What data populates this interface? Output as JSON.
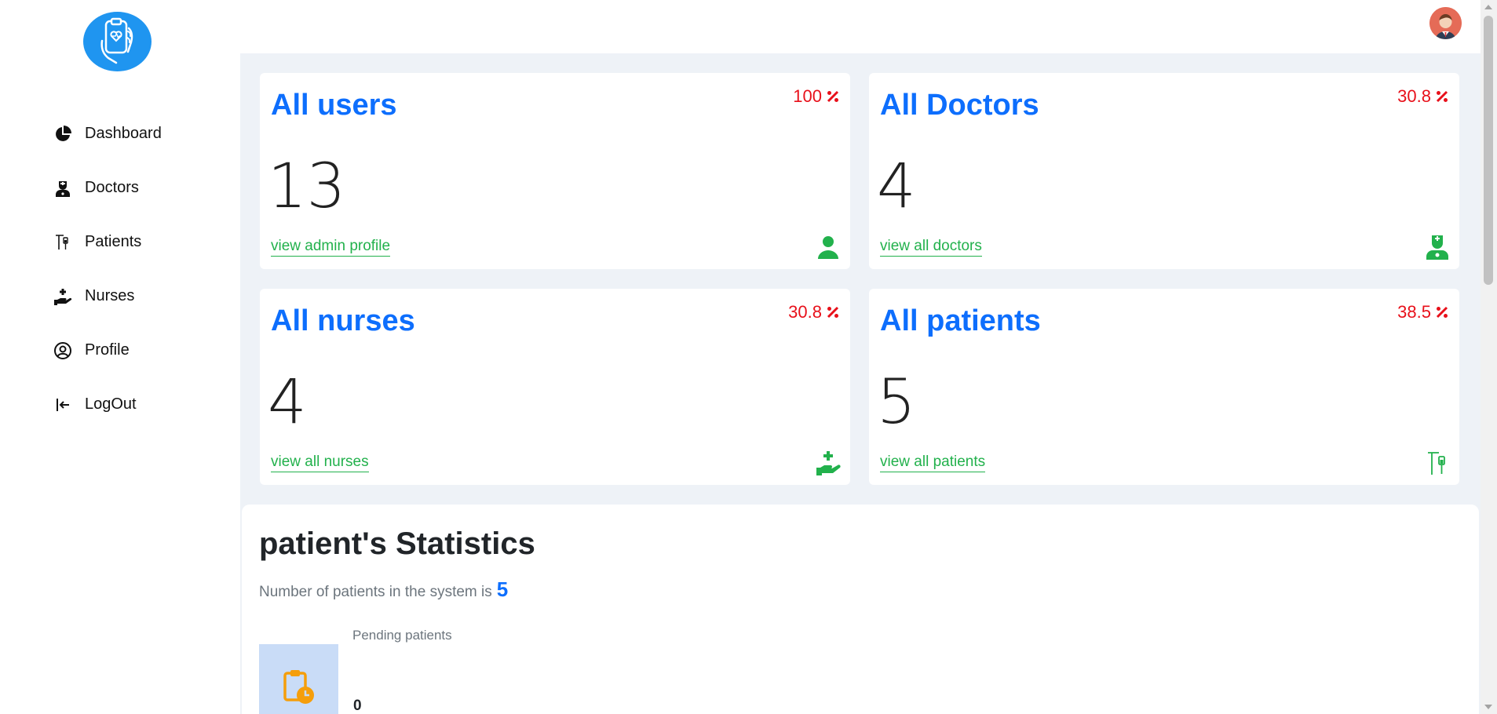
{
  "sidebar": {
    "logo_icon": "clipboard-heart-hand-icon",
    "items": [
      {
        "label": "Dashboard",
        "icon": "pie-chart-icon"
      },
      {
        "label": "Doctors",
        "icon": "doctor-icon"
      },
      {
        "label": "Patients",
        "icon": "iv-drip-icon"
      },
      {
        "label": "Nurses",
        "icon": "hand-plus-icon"
      },
      {
        "label": "Profile",
        "icon": "user-circle-icon"
      },
      {
        "label": "LogOut",
        "icon": "logout-icon"
      }
    ]
  },
  "header": {
    "avatar_icon": "user-avatar"
  },
  "cards": [
    {
      "title": "All users",
      "percent": "100",
      "count": "13",
      "link": "view admin profile",
      "icon": "user-icon"
    },
    {
      "title": "All Doctors",
      "percent": "30.8",
      "count": "4",
      "link": "view all doctors",
      "icon": "doctor-icon"
    },
    {
      "title": "All nurses",
      "percent": "30.8",
      "count": "4",
      "link": "view all nurses",
      "icon": "hand-plus-icon"
    },
    {
      "title": "All patients",
      "percent": "38.5",
      "count": "5",
      "link": "view all patients",
      "icon": "iv-drip-icon"
    }
  ],
  "statistics": {
    "title": "patient's Statistics",
    "subtitle": "Number of patients in the system is",
    "patient_count": "5",
    "pending_label": "Pending patients",
    "pending_value": "0",
    "pending_icon": "clipboard-clock-icon"
  },
  "colors": {
    "primary": "#0d6efd",
    "link_green": "#22b14c",
    "percent_red": "#e8101a",
    "logo_blue": "#1f95f0",
    "pending_box": "#c9dcf7",
    "pending_icon": "#f59e0b"
  }
}
